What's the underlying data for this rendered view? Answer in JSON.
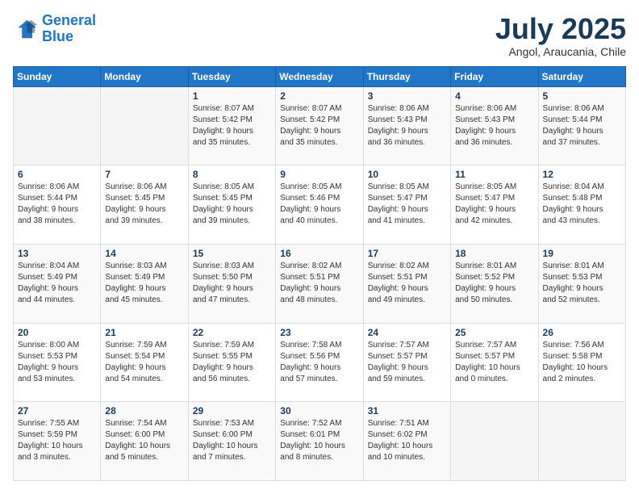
{
  "logo": {
    "line1": "General",
    "line2": "Blue"
  },
  "title": "July 2025",
  "subtitle": "Angol, Araucania, Chile",
  "days_header": [
    "Sunday",
    "Monday",
    "Tuesday",
    "Wednesday",
    "Thursday",
    "Friday",
    "Saturday"
  ],
  "weeks": [
    [
      {
        "day": "",
        "info": ""
      },
      {
        "day": "",
        "info": ""
      },
      {
        "day": "1",
        "info": "Sunrise: 8:07 AM\nSunset: 5:42 PM\nDaylight: 9 hours\nand 35 minutes."
      },
      {
        "day": "2",
        "info": "Sunrise: 8:07 AM\nSunset: 5:42 PM\nDaylight: 9 hours\nand 35 minutes."
      },
      {
        "day": "3",
        "info": "Sunrise: 8:06 AM\nSunset: 5:43 PM\nDaylight: 9 hours\nand 36 minutes."
      },
      {
        "day": "4",
        "info": "Sunrise: 8:06 AM\nSunset: 5:43 PM\nDaylight: 9 hours\nand 36 minutes."
      },
      {
        "day": "5",
        "info": "Sunrise: 8:06 AM\nSunset: 5:44 PM\nDaylight: 9 hours\nand 37 minutes."
      }
    ],
    [
      {
        "day": "6",
        "info": "Sunrise: 8:06 AM\nSunset: 5:44 PM\nDaylight: 9 hours\nand 38 minutes."
      },
      {
        "day": "7",
        "info": "Sunrise: 8:06 AM\nSunset: 5:45 PM\nDaylight: 9 hours\nand 39 minutes."
      },
      {
        "day": "8",
        "info": "Sunrise: 8:05 AM\nSunset: 5:45 PM\nDaylight: 9 hours\nand 39 minutes."
      },
      {
        "day": "9",
        "info": "Sunrise: 8:05 AM\nSunset: 5:46 PM\nDaylight: 9 hours\nand 40 minutes."
      },
      {
        "day": "10",
        "info": "Sunrise: 8:05 AM\nSunset: 5:47 PM\nDaylight: 9 hours\nand 41 minutes."
      },
      {
        "day": "11",
        "info": "Sunrise: 8:05 AM\nSunset: 5:47 PM\nDaylight: 9 hours\nand 42 minutes."
      },
      {
        "day": "12",
        "info": "Sunrise: 8:04 AM\nSunset: 5:48 PM\nDaylight: 9 hours\nand 43 minutes."
      }
    ],
    [
      {
        "day": "13",
        "info": "Sunrise: 8:04 AM\nSunset: 5:49 PM\nDaylight: 9 hours\nand 44 minutes."
      },
      {
        "day": "14",
        "info": "Sunrise: 8:03 AM\nSunset: 5:49 PM\nDaylight: 9 hours\nand 45 minutes."
      },
      {
        "day": "15",
        "info": "Sunrise: 8:03 AM\nSunset: 5:50 PM\nDaylight: 9 hours\nand 47 minutes."
      },
      {
        "day": "16",
        "info": "Sunrise: 8:02 AM\nSunset: 5:51 PM\nDaylight: 9 hours\nand 48 minutes."
      },
      {
        "day": "17",
        "info": "Sunrise: 8:02 AM\nSunset: 5:51 PM\nDaylight: 9 hours\nand 49 minutes."
      },
      {
        "day": "18",
        "info": "Sunrise: 8:01 AM\nSunset: 5:52 PM\nDaylight: 9 hours\nand 50 minutes."
      },
      {
        "day": "19",
        "info": "Sunrise: 8:01 AM\nSunset: 5:53 PM\nDaylight: 9 hours\nand 52 minutes."
      }
    ],
    [
      {
        "day": "20",
        "info": "Sunrise: 8:00 AM\nSunset: 5:53 PM\nDaylight: 9 hours\nand 53 minutes."
      },
      {
        "day": "21",
        "info": "Sunrise: 7:59 AM\nSunset: 5:54 PM\nDaylight: 9 hours\nand 54 minutes."
      },
      {
        "day": "22",
        "info": "Sunrise: 7:59 AM\nSunset: 5:55 PM\nDaylight: 9 hours\nand 56 minutes."
      },
      {
        "day": "23",
        "info": "Sunrise: 7:58 AM\nSunset: 5:56 PM\nDaylight: 9 hours\nand 57 minutes."
      },
      {
        "day": "24",
        "info": "Sunrise: 7:57 AM\nSunset: 5:57 PM\nDaylight: 9 hours\nand 59 minutes."
      },
      {
        "day": "25",
        "info": "Sunrise: 7:57 AM\nSunset: 5:57 PM\nDaylight: 10 hours\nand 0 minutes."
      },
      {
        "day": "26",
        "info": "Sunrise: 7:56 AM\nSunset: 5:58 PM\nDaylight: 10 hours\nand 2 minutes."
      }
    ],
    [
      {
        "day": "27",
        "info": "Sunrise: 7:55 AM\nSunset: 5:59 PM\nDaylight: 10 hours\nand 3 minutes."
      },
      {
        "day": "28",
        "info": "Sunrise: 7:54 AM\nSunset: 6:00 PM\nDaylight: 10 hours\nand 5 minutes."
      },
      {
        "day": "29",
        "info": "Sunrise: 7:53 AM\nSunset: 6:00 PM\nDaylight: 10 hours\nand 7 minutes."
      },
      {
        "day": "30",
        "info": "Sunrise: 7:52 AM\nSunset: 6:01 PM\nDaylight: 10 hours\nand 8 minutes."
      },
      {
        "day": "31",
        "info": "Sunrise: 7:51 AM\nSunset: 6:02 PM\nDaylight: 10 hours\nand 10 minutes."
      },
      {
        "day": "",
        "info": ""
      },
      {
        "day": "",
        "info": ""
      }
    ]
  ]
}
